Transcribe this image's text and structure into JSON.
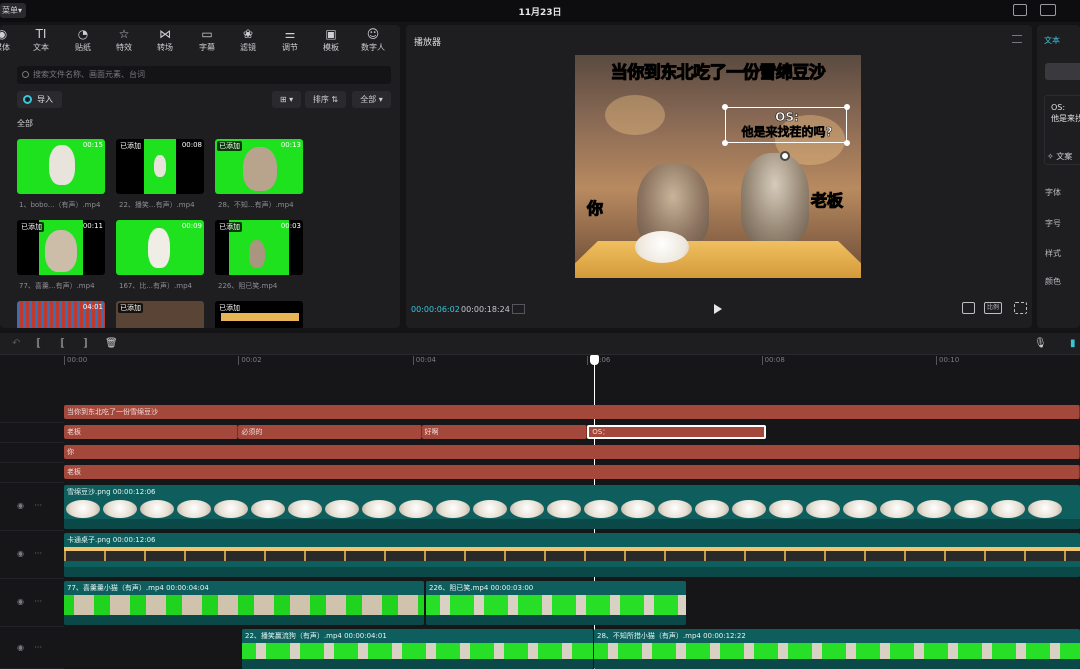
{
  "app": {
    "menu_label": "菜单",
    "date_title": "11月23日",
    "accent": "#39c6d9"
  },
  "media": {
    "toolbar": [
      {
        "label": "媒体",
        "icon": "media-icon"
      },
      {
        "label": "文本",
        "icon": "text-icon"
      },
      {
        "label": "贴纸",
        "icon": "sticker-icon"
      },
      {
        "label": "特效",
        "icon": "effects-icon"
      },
      {
        "label": "转场",
        "icon": "transition-icon"
      },
      {
        "label": "字幕",
        "icon": "caption-icon"
      },
      {
        "label": "滤镜",
        "icon": "filter-icon"
      },
      {
        "label": "调节",
        "icon": "adjust-icon"
      },
      {
        "label": "模板",
        "icon": "template-icon"
      },
      {
        "label": "数字人",
        "icon": "avatar-icon"
      }
    ],
    "search_placeholder": "搜索文件名称、画面元素、台词",
    "import_label": "导入",
    "sort_label": "排序",
    "filter_label": "全部",
    "section_label": "全部",
    "items": [
      {
        "name": "1、bobo...（有声）.mp4",
        "duration": "00:15",
        "added": ""
      },
      {
        "name": "22、播笑...有声）.mp4",
        "duration": "00:08",
        "added": "已添加"
      },
      {
        "name": "28、不知...有声）.mp4",
        "duration": "00:13",
        "added": "已添加"
      },
      {
        "name": "77、喜羹...有声）.mp4",
        "duration": "00:11",
        "added": "已添加"
      },
      {
        "name": "167、比...有声）.mp4",
        "duration": "00:09",
        "added": ""
      },
      {
        "name": "226、阻已笑.mp4",
        "duration": "00:03",
        "added": "已添加"
      },
      {
        "name": "",
        "duration": "04:01",
        "added": ""
      },
      {
        "name": "",
        "duration": "",
        "added": "已添加"
      },
      {
        "name": "",
        "duration": "",
        "added": "已添加"
      }
    ]
  },
  "player": {
    "title": "播放器",
    "headline": "当你到东北吃了一份雪绵豆沙",
    "label_left": "你",
    "label_right": "老板",
    "os_line1": "OS:",
    "os_line2": "他是来找茬的吗?",
    "current_time": "00:00:06:02",
    "total_time": "00:00:18:24",
    "ratio_label": "比例"
  },
  "text_panel": {
    "title": "文本",
    "preview_line1": "OS:",
    "preview_line2": "他是来找",
    "ai_label": "文案",
    "font_label": "字体",
    "size_label": "字号",
    "style_label": "样式",
    "color_label": "颜色"
  },
  "timeline": {
    "ruler": [
      "00:00",
      "00:02",
      "00:04",
      "00:06",
      "00:08",
      "00:10"
    ],
    "text_tracks": [
      [
        {
          "text": "当你到东北吃了一份雪绵豆沙",
          "start": 0,
          "end": 18.9
        }
      ],
      [
        {
          "text": "老板",
          "start": 0,
          "end": 2.0
        },
        {
          "text": "必须的",
          "start": 2.0,
          "end": 4.1
        },
        {
          "text": "好啊",
          "start": 4.1,
          "end": 6.0
        },
        {
          "text": "OS：",
          "start": 6.0,
          "end": 8.05,
          "selected": true
        }
      ],
      [
        {
          "text": "你",
          "start": 0,
          "end": 18.9
        }
      ],
      [
        {
          "text": "老板",
          "start": 0,
          "end": 18.9
        }
      ]
    ],
    "media_tracks": [
      {
        "clips": [
          {
            "title": "雪绵豆沙.png  00:00:12:06",
            "kind": "dumpling"
          }
        ]
      },
      {
        "clips": [
          {
            "title": "卡通桌子.png  00:00:12:06",
            "kind": "table"
          }
        ]
      },
      {
        "clips": [
          {
            "title": "77、喜羹羹小猫（有声）.mp4  00:00:04:04",
            "kind": "cat"
          },
          {
            "title": "226、阻已笑.mp4  00:00:03:00",
            "kind": "green"
          }
        ]
      },
      {
        "clips": [
          {
            "title": "22、播笑赢流狗（有声）.mp4  00:00:04:01",
            "kind": "green"
          },
          {
            "title": "28、不知所措小猫（有声）.mp4  00:00:12:22",
            "kind": "green"
          }
        ]
      }
    ]
  }
}
